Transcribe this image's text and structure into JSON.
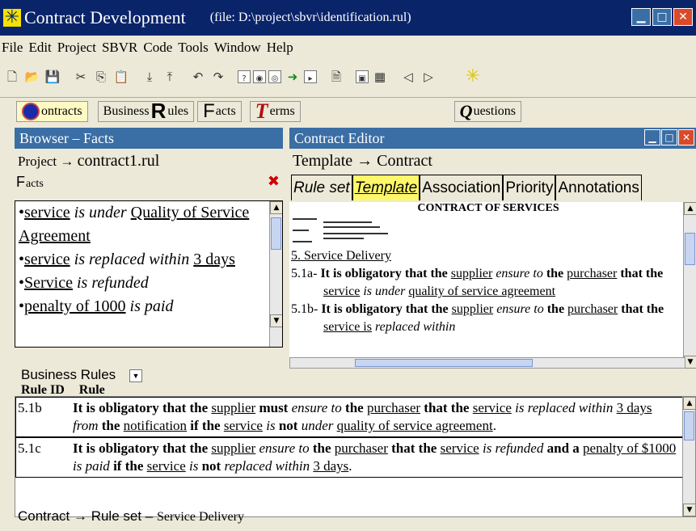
{
  "window": {
    "title": "Contract Development",
    "file": "(file: D:\\project\\sbvr\\identification.rul)"
  },
  "menu": [
    "File",
    "Edit",
    "Project",
    "SBVR",
    "Code",
    "Tools",
    "Window",
    "Help"
  ],
  "main_tabs": {
    "contracts": "ontracts",
    "business_rules_a": "Business",
    "business_rules_b": "ules",
    "facts": "acts",
    "terms": "erms",
    "questions": "uestions"
  },
  "browser": {
    "title": "Browser – Facts",
    "project_label": "Project →",
    "project_file": "contract1.rul",
    "facts_label": "acts",
    "facts": [
      {
        "a": "service",
        "b": " is under ",
        "c": "Quality of Service Agreement"
      },
      {
        "a": "service",
        "b": " is replaced within ",
        "c": "3 days"
      },
      {
        "a": "Service",
        "b": " is refunded",
        "c": ""
      },
      {
        "a": "penalty of 1000",
        "b": " is paid",
        "c": ""
      }
    ]
  },
  "editor": {
    "title": "Contract Editor",
    "template_label": "Template → Contract",
    "tabs": [
      "Rule set",
      "Template",
      "Association",
      "Priority",
      "Annotations"
    ],
    "doc_heading": "CONTRACT OF SERVICES",
    "section": "5. Service Delivery",
    "rule_a": {
      "id": "5.1a-",
      "t1": "It is obligatory that the",
      "t2": "supplier",
      "t3": "ensure to",
      "t4": "the",
      "t5": "purchaser",
      "t6": "that the",
      "t7": "service",
      "t8": "is under",
      "t9": "quality of service agreement"
    },
    "rule_b": {
      "id": "5.1b-",
      "t1": "It is obligatory that the",
      "t2": "supplier",
      "t3": "ensure to",
      "t4": "the",
      "t5": "purchaser",
      "t6": "that the",
      "t7": "service is",
      "t8": "replaced within"
    }
  },
  "business_rules": {
    "title": "Business Rules",
    "col_id": "Rule ID",
    "col_rule": "Rule",
    "rows": [
      {
        "id": "5.1b",
        "t1": "It is obligatory that the",
        "t2": "supplier",
        "t3": "must",
        "t4": "ensure to",
        "t5": "the",
        "t6": "purchaser",
        "t7": "that the",
        "t8": "service",
        "t9": "is",
        "t10": "replaced within",
        "t11": "3 days",
        "t12": "from",
        "t13": "the",
        "t14": "notification",
        "t15": "if the",
        "t16": "service",
        "t17": "is",
        "t18": "not",
        "t19": "under",
        "t20": "quality of service agreement",
        "t21": "."
      },
      {
        "id": "5.1c",
        "t1": "It is obligatory that the",
        "t2": "supplier",
        "t3": "ensure to",
        "t4": "the",
        "t5": "purchaser",
        "t6": "that the",
        "t7": "service",
        "t8": "is refunded",
        "t9": "and a",
        "t10": "penalty of $1000",
        "t11": "is paid",
        "t12": "if the",
        "t13": "service",
        "t14": "is",
        "t15": "not",
        "t16": "replaced within",
        "t17": "3 days",
        "t18": "."
      }
    ]
  },
  "status": {
    "path": "Contract → Rule set –",
    "section": "Service Delivery"
  }
}
